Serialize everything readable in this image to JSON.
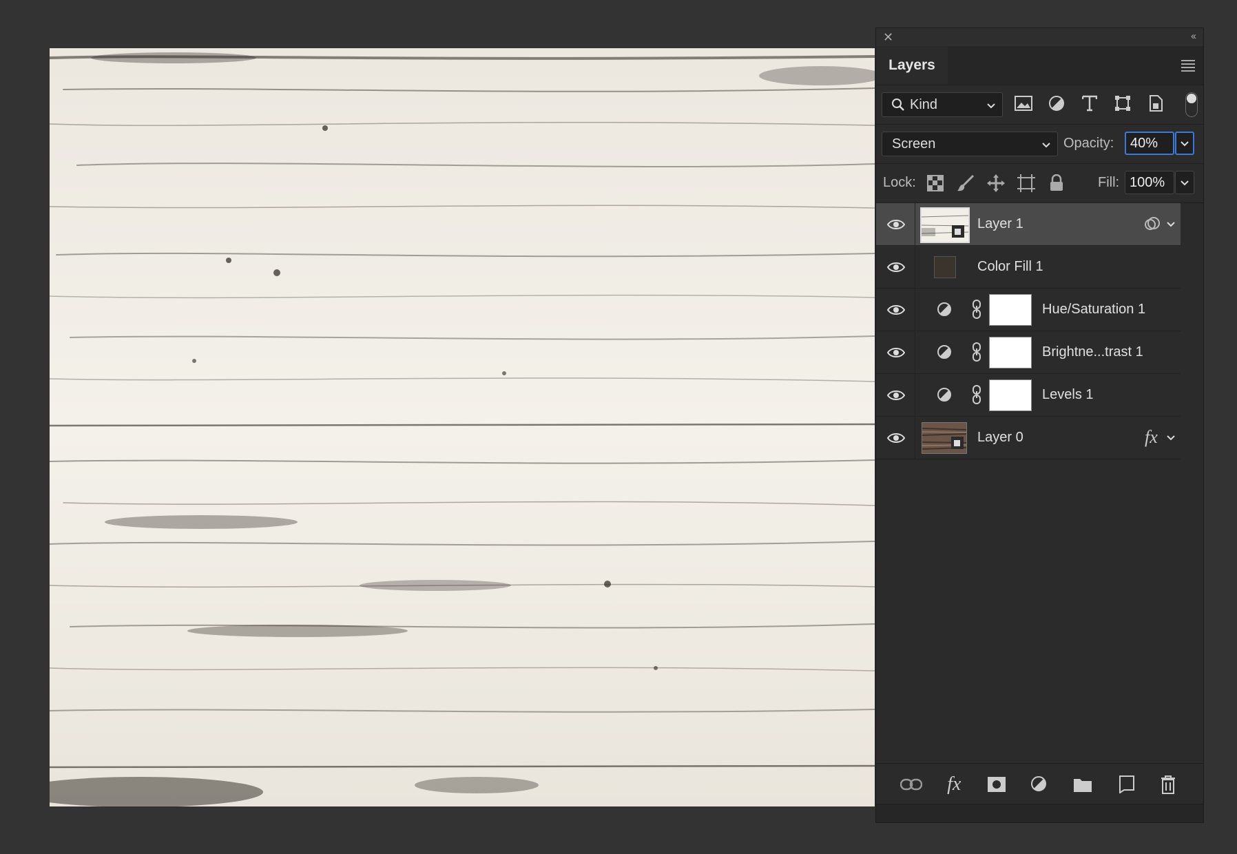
{
  "panel": {
    "close_label": "✕",
    "collapse_label": "‹‹",
    "tab_label": "Layers",
    "filter": {
      "kind_label": "Kind"
    },
    "blend_mode": "Screen",
    "opacity_label": "Opacity:",
    "opacity_value": "40%",
    "lock_label": "Lock:",
    "fill_label": "Fill:",
    "fill_value": "100%",
    "layers": [
      {
        "name": "Layer 1",
        "selected": true
      },
      {
        "name": "Color Fill 1",
        "swatch": "#3b342c"
      },
      {
        "name": "Hue/Saturation 1"
      },
      {
        "name": "Brightne...trast 1"
      },
      {
        "name": "Levels 1"
      },
      {
        "name": "Layer 0",
        "fx": "fx"
      }
    ]
  },
  "colors": {
    "app_bg": "#333333",
    "panel_bg": "#2b2b2b",
    "selected_row": "#4a4a4a",
    "accent": "#3b78d8"
  },
  "icons": {
    "filter": [
      "search-icon",
      "image-filter-icon",
      "adjustment-filter-icon",
      "type-filter-icon",
      "shape-filter-icon",
      "smart-object-filter-icon"
    ],
    "lock": [
      "lock-transparent-icon",
      "lock-brush-icon",
      "lock-move-icon",
      "lock-artboard-icon",
      "lock-all-icon"
    ],
    "bottom": [
      "link-icon",
      "fx-icon",
      "mask-icon",
      "adjustment-icon",
      "folder-icon",
      "new-layer-icon",
      "trash-icon"
    ]
  }
}
